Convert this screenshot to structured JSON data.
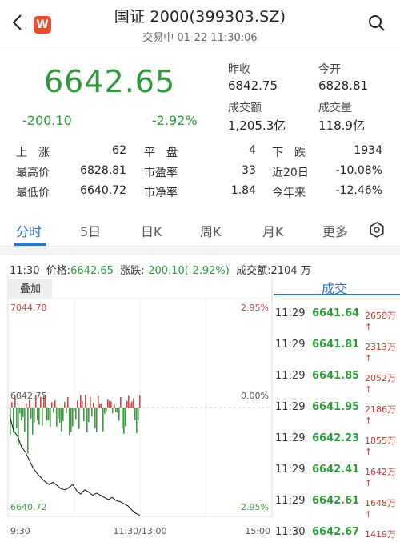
{
  "header": {
    "app_logo": "W",
    "title": "国证 2000(399303.SZ)",
    "subtitle": "交易中 01-22 11:30:06"
  },
  "quote": {
    "price": "6642.65",
    "change": "-200.10",
    "change_pct": "-2.92%",
    "prev_close_label": "昨收",
    "prev_close": "6842.75",
    "open_label": "今开",
    "open": "6828.81",
    "turnover_label": "成交额",
    "turnover": "1,205.3亿",
    "volume_label": "成交量",
    "volume": "118.9亿"
  },
  "stats": {
    "rise_label": "上　涨",
    "rise": "62",
    "flat_label": "平　盘",
    "flat": "4",
    "fall_label": "下　跌",
    "fall": "1934",
    "high_label": "最高价",
    "high": "6828.81",
    "pe_label": "市盈率",
    "pe": "33",
    "d20_label": "近20日",
    "d20": "-10.08%",
    "low_label": "最低价",
    "low": "6640.72",
    "pb_label": "市净率",
    "pb": "1.84",
    "ytd_label": "今年来",
    "ytd": "-12.46%"
  },
  "tabs": [
    "分时",
    "5日",
    "日K",
    "周K",
    "月K",
    "更多"
  ],
  "info": {
    "time": "11:30",
    "price_label": "价格:",
    "price": "6642.65",
    "chg_label": "涨跌:",
    "chg": "-200.10(-2.92%)",
    "amount_label": "成交额:",
    "amount": "2104 万"
  },
  "chart": {
    "overlay_label": "叠加",
    "y_top": "7044.78",
    "y_mid": "6842.75",
    "y_bottom": "6640.72",
    "pct_top": "2.95%",
    "pct_mid": "0.00%",
    "pct_bottom": "-2.95%",
    "x_start": "9:30",
    "x_mid": "11:30/13:00",
    "x_end": "15:00",
    "up_color": "#c94a4a",
    "down_color": "#3f9a42"
  },
  "chart_data": {
    "type": "line",
    "x": [
      "9:30",
      "11:30/13:00",
      "15:00"
    ],
    "ylim": [
      6640.72,
      7044.78
    ],
    "reference": 6842.75,
    "series": [
      {
        "values": [
          6828.8,
          6800,
          6790,
          6770,
          6760,
          6745,
          6730,
          6720,
          6712,
          6705,
          6700,
          6704,
          6698,
          6692,
          6690,
          6694,
          6700,
          6688,
          6682,
          6690,
          6686,
          6680,
          6684,
          6680,
          6676,
          6672,
          6676,
          6670,
          6668,
          6664,
          6660,
          6652,
          6646,
          6642.65
        ]
      }
    ]
  },
  "trades": {
    "header": "成交",
    "rows": [
      {
        "time": "11:29",
        "price": "6641.64",
        "vol": "2658万"
      },
      {
        "time": "11:29",
        "price": "6641.81",
        "vol": "2313万"
      },
      {
        "time": "11:29",
        "price": "6641.85",
        "vol": "2052万"
      },
      {
        "time": "11:29",
        "price": "6641.95",
        "vol": "2186万"
      },
      {
        "time": "11:29",
        "price": "6642.23",
        "vol": "1855万"
      },
      {
        "time": "11:29",
        "price": "6642.41",
        "vol": "1642万"
      },
      {
        "time": "11:29",
        "price": "6642.61",
        "vol": "1648万"
      },
      {
        "time": "11:30",
        "price": "6642.67",
        "vol": "1419万"
      }
    ]
  }
}
